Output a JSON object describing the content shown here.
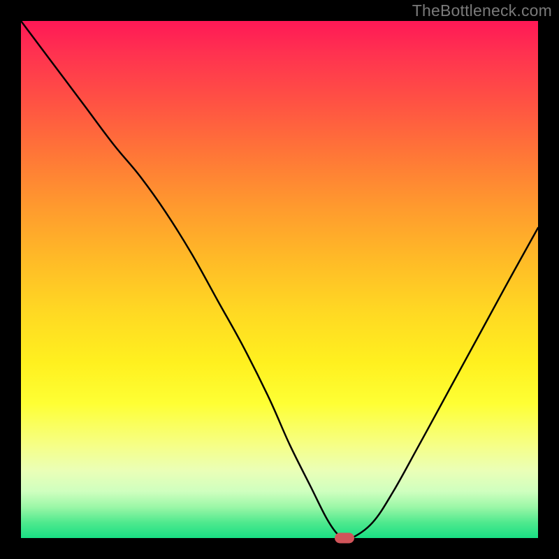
{
  "watermark": "TheBottleneck.com",
  "chart_data": {
    "type": "line",
    "title": "",
    "xlabel": "",
    "ylabel": "",
    "xlim": [
      0,
      100
    ],
    "ylim": [
      0,
      100
    ],
    "grid": false,
    "legend": false,
    "background": "red-yellow-green-vertical-gradient",
    "series": [
      {
        "name": "bottleneck-curve",
        "x": [
          0,
          6,
          12,
          18,
          23,
          28,
          33,
          38,
          43,
          48,
          52,
          56,
          59,
          61,
          62.5,
          64,
          68,
          72,
          77,
          83,
          89,
          95,
          100
        ],
        "y": [
          100,
          92,
          84,
          76,
          70,
          63,
          55,
          46,
          37,
          27,
          18,
          10,
          4,
          1,
          0,
          0,
          3,
          9,
          18,
          29,
          40,
          51,
          60
        ]
      }
    ],
    "marker": {
      "x": 62.5,
      "y": 0,
      "shape": "pill",
      "color": "#d1555a"
    }
  }
}
